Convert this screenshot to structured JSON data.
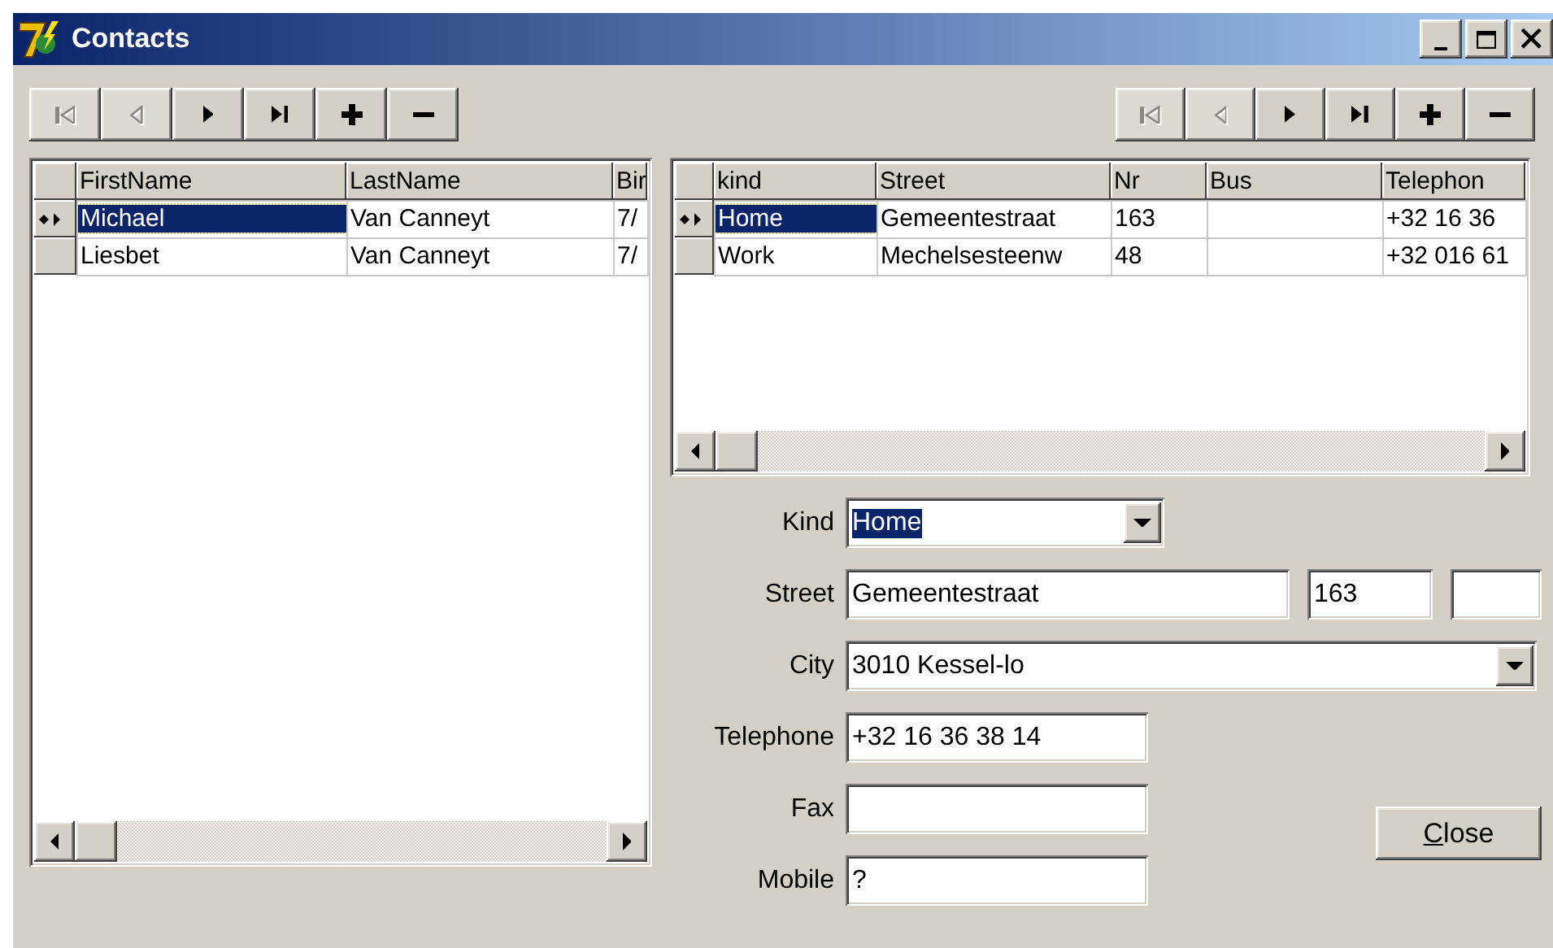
{
  "window": {
    "title": "Contacts",
    "controls": [
      {
        "kind": "minimize"
      },
      {
        "kind": "maximize"
      },
      {
        "kind": "close"
      }
    ]
  },
  "contacts_navigator": {
    "buttons": [
      {
        "kind": "first",
        "disabled": true
      },
      {
        "kind": "prior",
        "disabled": true
      },
      {
        "kind": "next",
        "disabled": false
      },
      {
        "kind": "last",
        "disabled": false
      },
      {
        "kind": "insert",
        "disabled": false
      },
      {
        "kind": "delete",
        "disabled": false
      }
    ]
  },
  "addresses_navigator": {
    "buttons": [
      {
        "kind": "first",
        "disabled": true
      },
      {
        "kind": "prior",
        "disabled": true
      },
      {
        "kind": "next",
        "disabled": false
      },
      {
        "kind": "last",
        "disabled": false
      },
      {
        "kind": "insert",
        "disabled": false
      },
      {
        "kind": "delete",
        "disabled": false
      }
    ]
  },
  "contacts_grid": {
    "columns": [
      "FirstName",
      "LastName",
      "Bir"
    ],
    "rows": [
      {
        "selected": true,
        "cells": [
          "Michael",
          "Van Canneyt",
          "7/"
        ]
      },
      {
        "selected": false,
        "cells": [
          "Liesbet",
          "Van Canneyt",
          "7/"
        ]
      }
    ]
  },
  "addresses_grid": {
    "columns": [
      "kind",
      "Street",
      "Nr",
      "Bus",
      "Telephon"
    ],
    "rows": [
      {
        "selected": true,
        "cells": [
          "Home",
          "Gemeentestraat",
          "163",
          null,
          "+32 16 36"
        ]
      },
      {
        "selected": false,
        "cells": [
          "Work",
          "Mechelsesteenw",
          "48",
          null,
          "+32 016 61"
        ]
      }
    ]
  },
  "detail_form": {
    "fields": [
      {
        "kind": "combo",
        "label": "Kind",
        "value": "Home",
        "highlighted": true
      },
      {
        "kind": "street",
        "label": "Street",
        "value": "Gemeentestraat",
        "number": "163"
      },
      {
        "kind": "wide-combo",
        "label": "City",
        "value": "3010 Kessel-lo",
        "highlighted": false
      },
      {
        "kind": "text",
        "label": "Telephone",
        "value": "+32 16 36 38 14"
      },
      {
        "kind": "text",
        "label": "Fax"
      },
      {
        "kind": "text",
        "label": "Mobile",
        "value": "?"
      }
    ],
    "close_button": {
      "label": "Close"
    }
  }
}
